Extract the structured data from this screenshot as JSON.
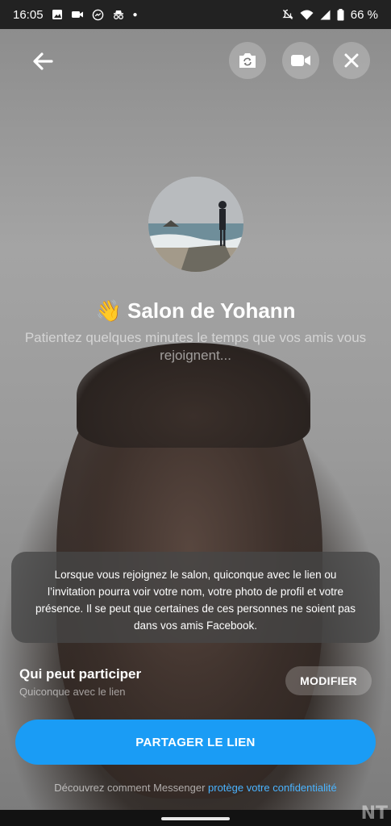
{
  "status_bar": {
    "time": "16:05",
    "battery": "66 %",
    "left_icons": [
      "image-icon",
      "video-icon",
      "messenger-icon",
      "incognito-icon",
      "dot-icon"
    ],
    "right_icons": [
      "mute-icon",
      "wifi-icon",
      "signal-icon",
      "battery-icon"
    ]
  },
  "room": {
    "emoji": "👋",
    "title": "Salon de Yohann",
    "waiting_text": "Patientez quelques minutes le temps que vos amis vous rejoignent..."
  },
  "info": {
    "text": "Lorsque vous rejoignez le salon, quiconque avec le lien ou l’invitation pourra voir votre nom, votre photo de profil et votre présence. Il se peut que certaines de ces personnes ne soient pas dans vos amis Facebook."
  },
  "participants": {
    "label": "Qui peut participer",
    "value": "Quiconque avec le lien",
    "modify_label": "MODIFIER"
  },
  "share": {
    "label": "PARTAGER LE LIEN"
  },
  "footer": {
    "text": "Découvrez comment Messenger ",
    "link": "protège votre confidentialité"
  },
  "watermark": "NT",
  "colors": {
    "primary": "#1a9cf5",
    "link": "#4ab3ff"
  }
}
